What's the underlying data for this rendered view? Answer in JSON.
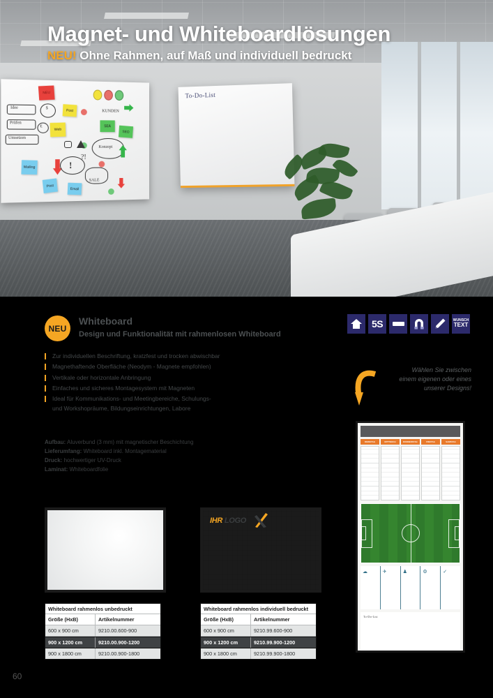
{
  "hero": {
    "title": "Magnet- und Whiteboardlösungen",
    "badge": "NEU!",
    "subtitle": "Ohne Rahmen, auf Maß und individuell bedruckt",
    "board_label": "To-Do-List",
    "sticky_notes": [
      "NEU",
      "Post",
      "Web",
      "Mailing",
      "Post",
      "Email",
      "SEA",
      "SEO"
    ],
    "ink_words": [
      "Idee",
      "Prüfen",
      "Umsetzen",
      "KUNDEN",
      "Konzept",
      "SALE"
    ]
  },
  "product": {
    "badge": "NEU",
    "title": "Whiteboard",
    "subtitle": "Design und Funktionalität mit rahmenlosen Whiteboard",
    "bullets": [
      {
        "text": "Zur individuellen Beschriftung, kratzfest und trocken abwischbar"
      },
      {
        "text": "Magnethaftende Oberfläche (Neodym - Magnete empfohlen)"
      },
      {
        "text": "Vertikale oder horizontale Anbringung"
      },
      {
        "text": "Einfaches und sicheres Montagesystem mit Magneten"
      },
      {
        "text": "Ideal für Kommunikations- und Meetingbereiche, Schulungs-",
        "cont": "und Workshopräume, Bildungseinrichtungen, Labore"
      }
    ],
    "specs": [
      {
        "label": "Aufbau:",
        "value": " Aluverbund (3 mm) mit magnetischer Beschichtung"
      },
      {
        "label": "Lieferumfang:",
        "value": " Whiteboard inkl. Montagematerial"
      },
      {
        "label": "Druck:",
        "value": " hochwertiger UV-Druck"
      },
      {
        "label": "Laminat:",
        "value": " Whiteboardfolie"
      }
    ]
  },
  "icons": [
    {
      "name": "house-icon",
      "label": ""
    },
    {
      "name": "5s-icon",
      "label": "5S"
    },
    {
      "name": "bar-icon",
      "label": ""
    },
    {
      "name": "magnet-icon",
      "label": ""
    },
    {
      "name": "pencil-icon",
      "label": ""
    },
    {
      "name": "wunschtext-icon",
      "label": "WUNSCH",
      "label2": "TEXT"
    }
  ],
  "callout": {
    "line1": "Wählen Sie zwischen",
    "line2": "einem eigenen oder eines",
    "line3": "unserer Designs!"
  },
  "mockups": {
    "logo_part1": "IHR",
    "logo_part2": "LOGO"
  },
  "tables": [
    {
      "title": "Whiteboard rahmenlos unbedruckt",
      "headers": [
        "Größe (HxB)",
        "Artikelnummer"
      ],
      "rows": [
        {
          "size": "600 x 900 cm",
          "sku": "9210.00.600-900",
          "style": "alt"
        },
        {
          "size": "900 x 1200 cm",
          "sku": "9210.00.900-1200",
          "style": "sel"
        },
        {
          "size": "900 x 1800 cm",
          "sku": "9210.00.900-1800",
          "style": "alt"
        }
      ]
    },
    {
      "title": "Whiteboard rahmenlos individuell bedruckt",
      "headers": [
        "Größe (HxB)",
        "Artikelnummer"
      ],
      "rows": [
        {
          "size": "600  x 900 cm",
          "sku": "9210.99.600-900",
          "style": "alt"
        },
        {
          "size": "900 x 1200 cm",
          "sku": "9210.99.900-1200",
          "style": "sel"
        },
        {
          "size": "900 x 1800 cm",
          "sku": "9210.99.900-1800",
          "style": "alt"
        }
      ]
    }
  ],
  "planning_board": {
    "days": [
      "DIENSTAG",
      "MITTWOCH",
      "DONNERSTAG",
      "FREITAG",
      "SAMSTAG"
    ],
    "todo_label": "To-Do-List",
    "kanban_icons": [
      "cloud-icon",
      "plane-icon",
      "worker-icon",
      "gear-icon",
      "check-icon"
    ]
  },
  "footer": {
    "page_number": "60"
  },
  "colors": {
    "accent_orange": "#f5a623",
    "icon_navy": "#2c2a6b",
    "day_orange": "#e8792a",
    "pitch_green": "#2f7a2c"
  }
}
